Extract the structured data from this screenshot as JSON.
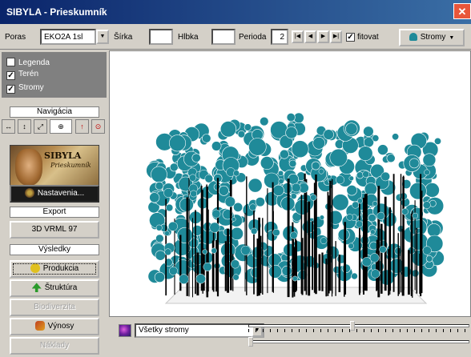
{
  "window": {
    "title": "SIBYLA - Prieskumník",
    "close_glyph": "✕"
  },
  "toolbar": {
    "plot_label": "Poras",
    "plot_value": "EKO2A 1sl",
    "plots_label": "Šírka",
    "plots_value": "",
    "height_label": "Hlbka",
    "height_value": "",
    "period_label": "Perioda",
    "period_value": "2",
    "nav_first": "|◀",
    "nav_prev": "◀",
    "nav_next": "▶",
    "nav_last": "▶|",
    "fit_checked": true,
    "fit_label": "fitovat",
    "trees_button": "Stromy"
  },
  "left_panel": {
    "layers": [
      {
        "label": "Legenda",
        "checked": false
      },
      {
        "label": "Terén",
        "checked": true
      },
      {
        "label": "Stromy",
        "checked": true
      }
    ],
    "navigation_header": "Navigácia",
    "nav_tools": [
      "↔",
      "↕",
      "⤢",
      "⊕",
      "↑",
      "⊙"
    ],
    "logo_title": "SIBYLA",
    "logo_subtitle": "Prieskumník",
    "settings_button": "Nastavenia...",
    "export_header": "Export",
    "vrml_button": "3D VRML 97",
    "results_header": "Výsledky",
    "results_buttons": [
      {
        "label": "Produkcia",
        "state": "focused"
      },
      {
        "label": "Štruktúra",
        "state": "enabled"
      },
      {
        "label": "Biodiverzita",
        "state": "disabled"
      },
      {
        "label": "Výnosy",
        "state": "enabled"
      },
      {
        "label": "Náklady",
        "state": "disabled"
      }
    ]
  },
  "bottom": {
    "species_value": "Všetky stromy",
    "slider_top_position": 0.47,
    "slider_bottom_position": 0
  },
  "colors": {
    "canopy": "#1f8a99",
    "trunk": "#000000",
    "titlebar": "#0a246a"
  }
}
